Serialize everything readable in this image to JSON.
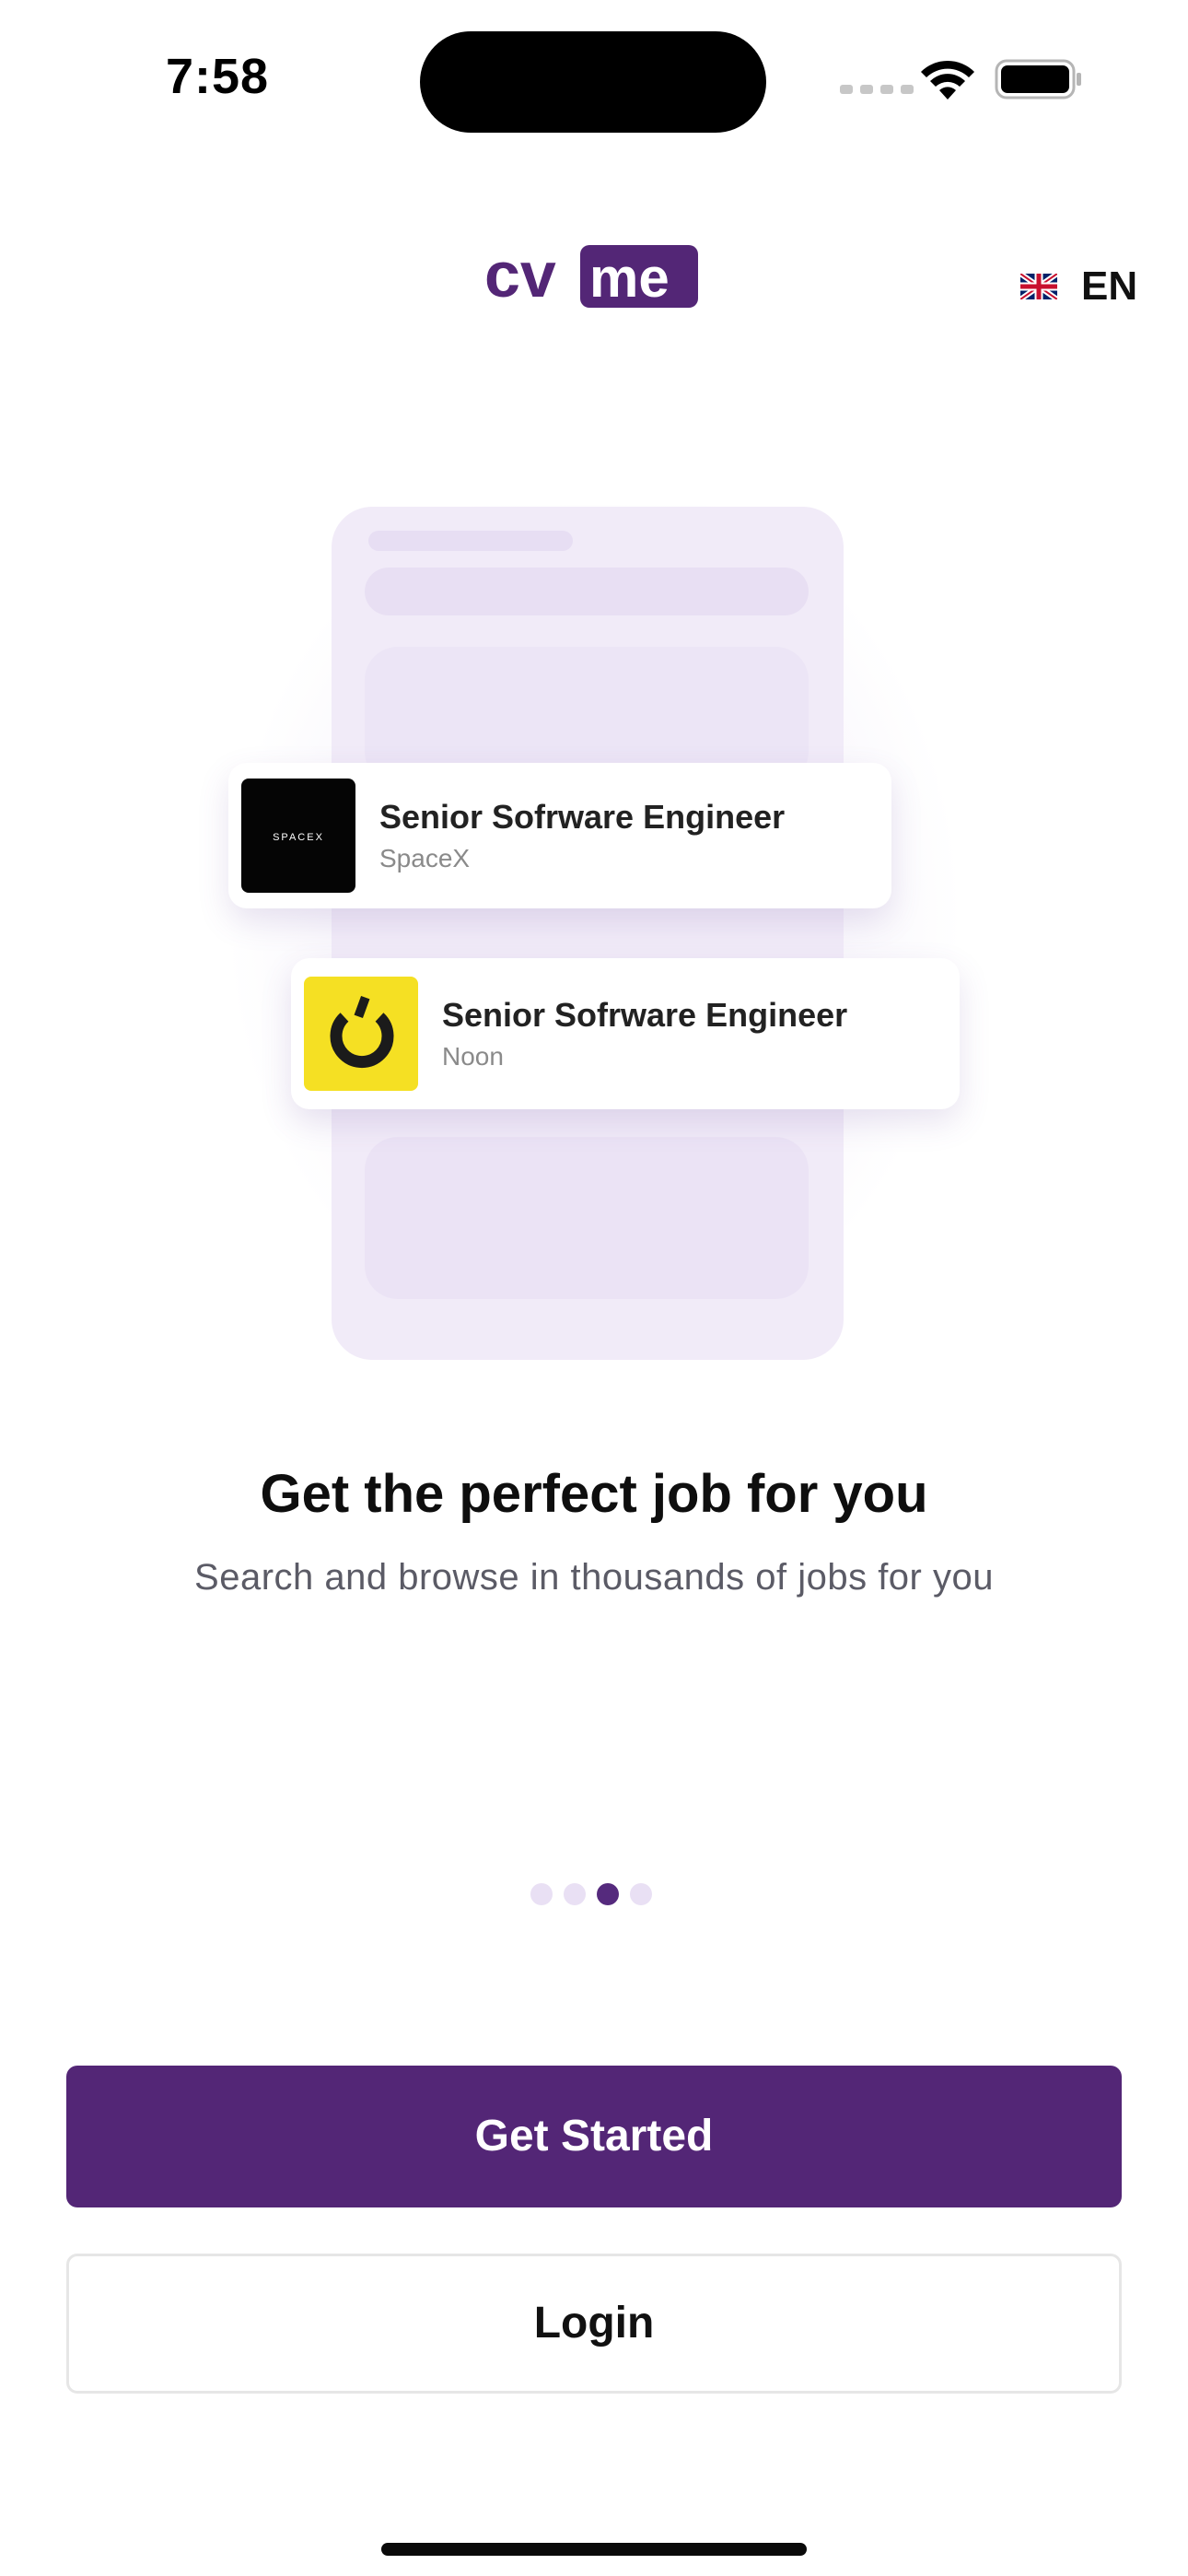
{
  "status_bar": {
    "time": "7:58"
  },
  "header": {
    "logo_text": "cvme",
    "language": {
      "label": "EN",
      "flag_icon": "uk-flag-icon"
    }
  },
  "illustration": {
    "jobs": [
      {
        "title": "Senior Sofrware Engineer",
        "company": "SpaceX",
        "logo_text": "SPACEX"
      },
      {
        "title": "Senior Sofrware Engineer",
        "company": "Noon"
      }
    ]
  },
  "onboarding": {
    "title": "Get the perfect job for you",
    "subtitle": "Search and browse in thousands of jobs for you",
    "page_count": 4,
    "active_page": 3
  },
  "actions": {
    "primary_label": "Get Started",
    "secondary_label": "Login"
  },
  "colors": {
    "brand_purple": "#532676",
    "dot_inactive": "#e9e0f4",
    "noon_yellow": "#f5e023"
  }
}
